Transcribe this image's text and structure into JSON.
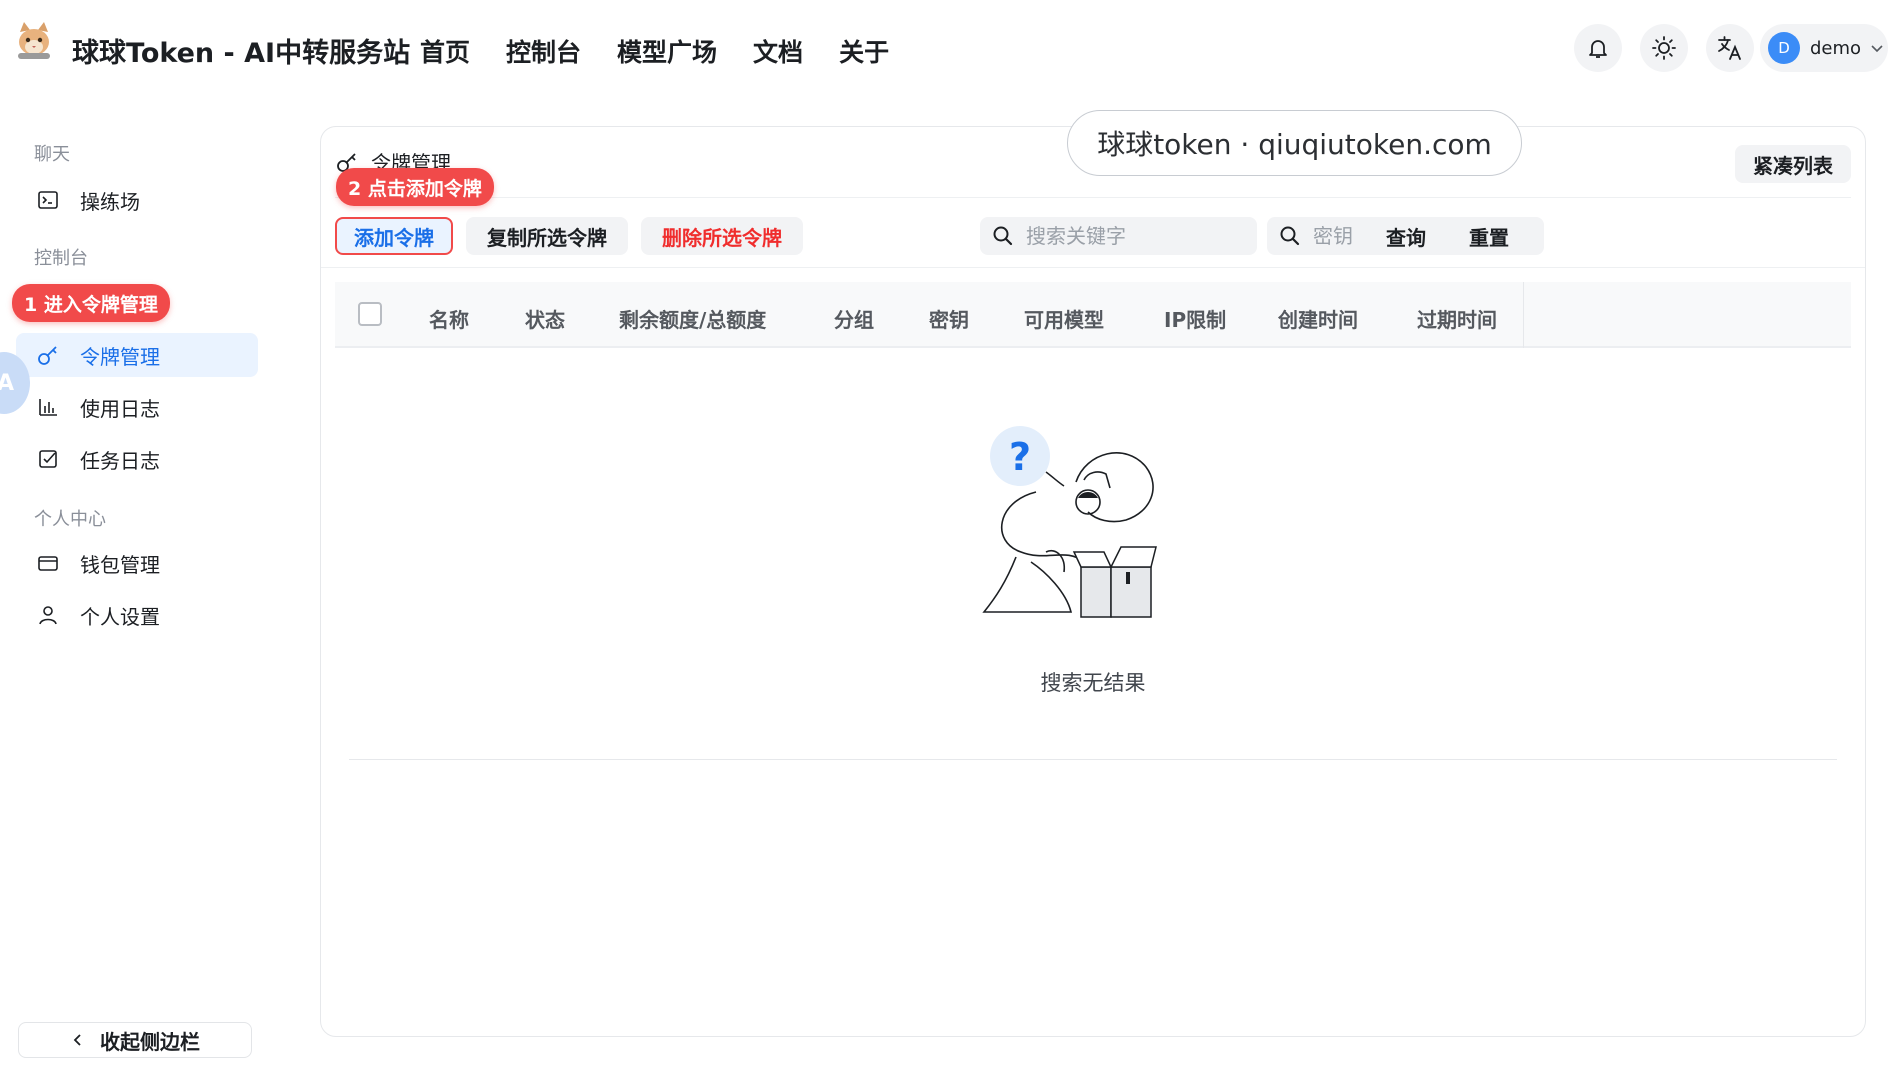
{
  "header": {
    "site_title": "球球Token - AI中转服务站",
    "nav": [
      "首页",
      "控制台",
      "模型广场",
      "文档",
      "关于"
    ],
    "user": {
      "initial": "D",
      "name": "demo"
    }
  },
  "sidebar": {
    "group_chat": "聊天",
    "item_playground": "操练场",
    "group_console": "控制台",
    "item_tokens": "令牌管理",
    "item_usage_log": "使用日志",
    "item_task_log": "任务日志",
    "group_personal": "个人中心",
    "item_wallet": "钱包管理",
    "item_settings": "个人设置",
    "collapse_label": "收起侧边栏",
    "edge_letter": "A"
  },
  "callouts": {
    "step1": "1 进入令牌管理",
    "step2": "2 点击添加令牌"
  },
  "main": {
    "title": "令牌管理",
    "compact_label": "紧凑列表",
    "watermark": "球球token · qiuqiutoken.com",
    "add_label": "添加令牌",
    "copy_label": "复制所选令牌",
    "delete_label": "删除所选令牌",
    "search_placeholder": "搜索关键字",
    "key_placeholder": "密钥",
    "query_label": "查询",
    "reset_label": "重置",
    "columns": [
      "名称",
      "状态",
      "剩余额度/总额度",
      "分组",
      "密钥",
      "可用模型",
      "IP限制",
      "创建时间",
      "过期时间"
    ],
    "empty_text": "搜索无结果"
  },
  "colors": {
    "accent": "#1a6fe8",
    "danger": "#f02d2d",
    "callout": "#f14a4a"
  }
}
